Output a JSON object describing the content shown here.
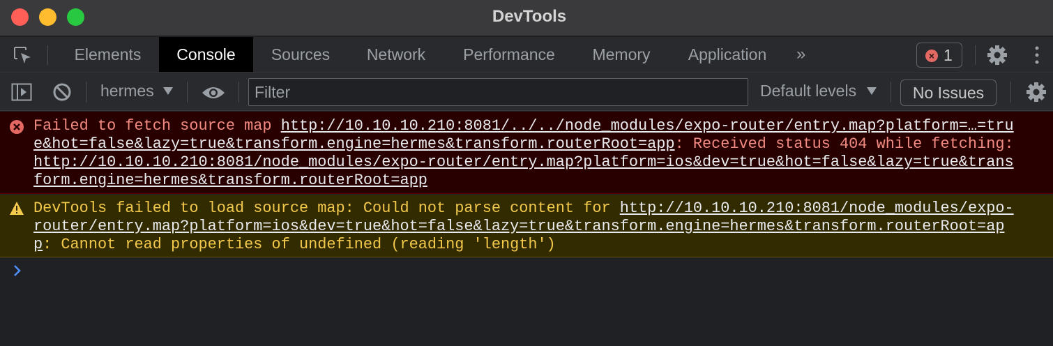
{
  "window": {
    "title": "DevTools"
  },
  "tabs": [
    "Elements",
    "Console",
    "Sources",
    "Network",
    "Performance",
    "Memory",
    "Application"
  ],
  "active_tab": "Console",
  "more_tabs_label": "»",
  "error_badge_count": "1",
  "toolbar": {
    "context": "hermes",
    "filter_placeholder": "Filter",
    "levels": "Default levels",
    "issues": "No Issues"
  },
  "messages": {
    "error": {
      "text1": "Failed to fetch source map ",
      "url1_part1": "http://10.10.10.210:8081/../../node_modules/expo-router/entry.map?platform=…=tru",
      "url1_part2": "e&hot=false&lazy=true&transform.engine=hermes&transform.routerRoot=app",
      "text2": ": Received status 404 while fetching:",
      "url2_part1": "http://10.10.10.210:8081/node_modules/expo-router/entry.map?platform=ios&dev=true&hot=false&lazy=true&trans",
      "url2_part2": "form.engine=hermes&transform.routerRoot=app"
    },
    "warning": {
      "text1": "DevTools failed to load source map: Could not parse content for ",
      "url_part1": "http://10.10.10.210:8081/node_modules/expo-",
      "url_part2": "router/entry.map?platform=ios&dev=true&hot=false&lazy=true&transform.engine=hermes&transform.routerRoot=ap",
      "url_part3": "p",
      "text2": ": Cannot read properties of undefined (reading 'length')"
    }
  },
  "colors": {
    "error_bg": "#290000",
    "error_text": "#f28b82",
    "warn_bg": "#332b00",
    "warn_text": "#f2c94c",
    "active_tab_bg": "#000000",
    "prompt": "#4d90fe"
  }
}
